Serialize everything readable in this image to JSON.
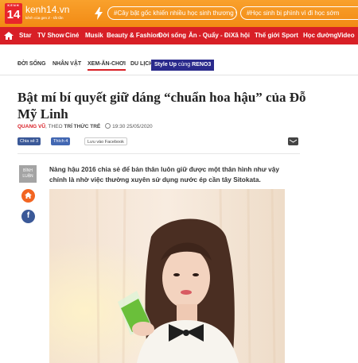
{
  "header": {
    "logo_text": "KENH 14",
    "brand": "kenh14.vn",
    "tagline": "kênh của gen Z - tất tần",
    "hot_topics": [
      "#Cây bật gốc khiến nhiều học sinh thương vong",
      "#Học sinh bị phình vì đi học sớm"
    ]
  },
  "nav": {
    "items": [
      "Star",
      "TV Show",
      "Ciné",
      "Musik",
      "Beauty & Fashion",
      "Đời sống",
      "Ăn - Quẩy - Đi",
      "Xã hội",
      "Thế giới",
      "Sport",
      "Học đường",
      "Video"
    ]
  },
  "subnav": {
    "items": [
      "ĐỜI SỐNG",
      "NHÂN VẬT",
      "XEM-ĂN-CHƠI",
      "DU LỊCH"
    ],
    "active": "XEM-ĂN-CHƠI",
    "promo": {
      "label": "Style Up",
      "mid": "cùng",
      "brand": "RENO3"
    }
  },
  "article": {
    "title": "Bật mí bí quyết giữ dáng “chuẩn hoa hậu” của Đỗ Mỹ Linh",
    "author": "QUANG VŨ",
    "source_prefix": ", THEO",
    "source": "TRÍ THỨC TRẺ",
    "timestamp": "19:30 25/05/2020",
    "share": {
      "fb_share": "Chia sẻ 3",
      "fb_like": "Thích 4",
      "save_fb": "Lưu vào Facebook"
    },
    "side": {
      "comment_label_1": "BÌNH",
      "comment_label_2": "LUẬN"
    },
    "lead": "Nàng hậu 2016 chia sẻ để bản thân luôn giữ được một thân hình như vậy chính là nhờ việc thường xuyên sử dụng nước ép cần tây Sitokata."
  },
  "colors": {
    "orange": "#f7941e",
    "red": "#d81f26",
    "navy": "#2a2a8c"
  }
}
